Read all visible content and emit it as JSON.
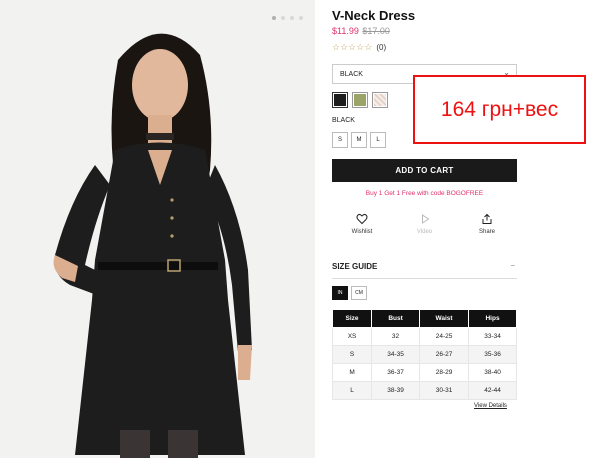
{
  "gallery": {
    "dots": 4,
    "active_dot": 0
  },
  "product": {
    "title": "V-Neck Dress",
    "price": "$11.99",
    "old_price": "$17.00",
    "review_count": "(0)",
    "rating": 0
  },
  "color_select": {
    "value": "BLACK"
  },
  "swatches": [
    {
      "name": "black",
      "color": "#1e1e1e",
      "selected": true
    },
    {
      "name": "olive",
      "color": "#9ba466",
      "selected": false
    },
    {
      "name": "pattern",
      "color": "#e7d2cc",
      "selected": false
    }
  ],
  "selected_color_label": "BLACK",
  "sizes": [
    "S",
    "M",
    "L"
  ],
  "add_to_cart": "ADD TO CART",
  "promo": "Buy 1 Get 1 Free with code BOGOFREE",
  "actions": {
    "wishlist": "Wishlist",
    "video": "Video",
    "share": "Share"
  },
  "size_guide": {
    "title": "SIZE GUIDE",
    "collapse_symbol": "−",
    "units": [
      "IN",
      "CM"
    ],
    "active_unit": "IN",
    "headers": [
      "Size",
      "Bust",
      "Waist",
      "Hips"
    ],
    "rows": [
      [
        "XS",
        "32",
        "24-25",
        "33-34"
      ],
      [
        "S",
        "34-35",
        "26-27",
        "35-36"
      ],
      [
        "M",
        "36-37",
        "28-29",
        "38-40"
      ],
      [
        "L",
        "38-39",
        "30-31",
        "42-44"
      ]
    ],
    "view_details": "View Details"
  },
  "annotation": {
    "text": "164 грн+вес",
    "color": "#e11111"
  }
}
